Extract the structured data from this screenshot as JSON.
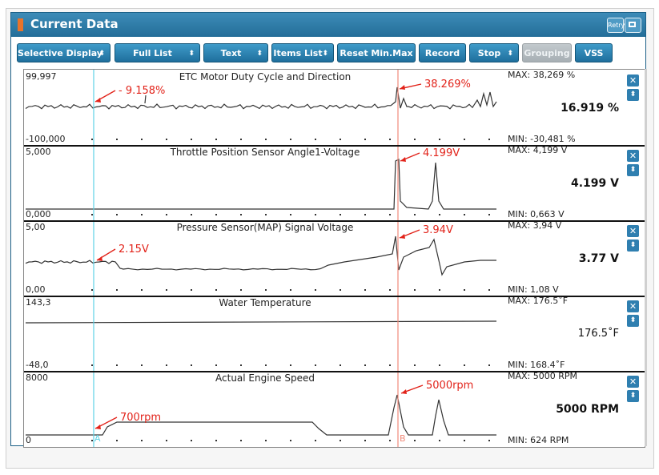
{
  "window": {
    "title": "Current Data",
    "retry_label": "Retry"
  },
  "toolbar": {
    "buttons": [
      {
        "label": "Selective Display",
        "arrows": "⬍",
        "disabled": false
      },
      {
        "label": "Full List",
        "arrows": "⬍",
        "disabled": false
      },
      {
        "label": "Text",
        "arrows": "⬍",
        "disabled": false
      },
      {
        "label": "Items List",
        "arrows": "⬍",
        "disabled": false
      },
      {
        "label": "Reset Min.Max",
        "arrows": "",
        "disabled": false
      },
      {
        "label": "Record",
        "arrows": "",
        "disabled": false
      },
      {
        "label": "Stop",
        "arrows": "⬍",
        "disabled": false
      },
      {
        "label": "Grouping",
        "arrows": "",
        "disabled": true
      },
      {
        "label": "VSS",
        "arrows": "",
        "disabled": false
      }
    ]
  },
  "cursors": {
    "a_label": "A",
    "b_label": "B",
    "a_color": "#5fd3e6",
    "b_color": "#f08a7a"
  },
  "panels": [
    {
      "title": "ETC Motor Duty Cycle and Direction",
      "axis_top": "99,997",
      "axis_bottom": "-100,000",
      "max_label": "MAX: 38,269 %",
      "min_label": "MIN: -30,481 %",
      "current": "16.919 %",
      "annotation_a": "- 9.158%",
      "annotation_b": "38.269%"
    },
    {
      "title": "Throttle Position Sensor Angle1-Voltage",
      "axis_top": "5,000",
      "axis_bottom": "0,000",
      "max_label": "MAX: 4,199 V",
      "min_label": "MIN: 0,663 V",
      "current": "4.199 V",
      "annotation_a": "",
      "annotation_b": "4.199V"
    },
    {
      "title": "Pressure Sensor(MAP) Signal Voltage",
      "axis_top": "5,00",
      "axis_bottom": "0,00",
      "max_label": "MAX:  3,94 V",
      "min_label": "MIN:  1,08 V",
      "current": "3.77 V",
      "annotation_a": "2.15V",
      "annotation_b": "3.94V"
    },
    {
      "title": "Water Temperature",
      "axis_top": "143,3",
      "axis_bottom": "-48,0",
      "max_label": "MAX:  176.5˚F",
      "min_label": "MIN:   168.4˚F",
      "current": "176.5˚F",
      "annotation_a": "",
      "annotation_b": ""
    },
    {
      "title": "Actual Engine Speed",
      "axis_top": "8000",
      "axis_bottom": "0",
      "max_label": "MAX:  5000 RPM",
      "min_label": "MIN:   624 RPM",
      "current": "5000 RPM",
      "annotation_a": "700rpm",
      "annotation_b": "5000rpm"
    }
  ],
  "colors": {
    "accent": "#2a7cab",
    "annotation": "#e2231a",
    "trace": "#333333"
  }
}
